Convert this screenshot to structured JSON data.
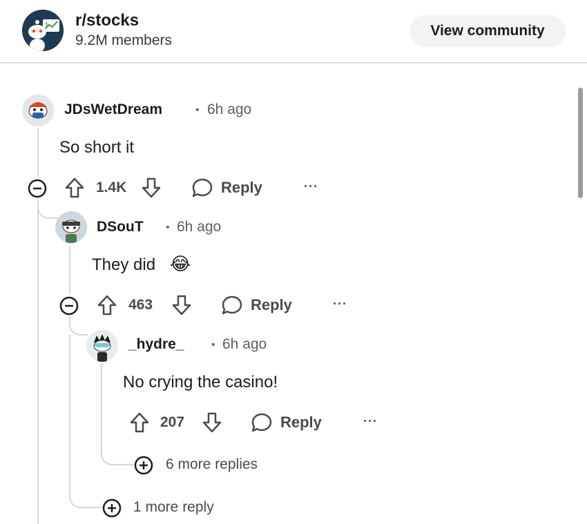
{
  "header": {
    "subreddit": "r/stocks",
    "members": "9.2M members",
    "view_button": "View community"
  },
  "comments": [
    {
      "author": "JDsWetDream",
      "separator": "•",
      "time": "6h ago",
      "text": "So short it",
      "score": "1.4K",
      "reply_label": "Reply",
      "more_label": "···"
    },
    {
      "author": "DSouT",
      "separator": "•",
      "time": "6h ago",
      "text": "They did",
      "emoji": "😂",
      "score": "463",
      "reply_label": "Reply",
      "more_label": "···"
    },
    {
      "author": "_hydre_",
      "separator": "•",
      "time": "6h ago",
      "text": "No crying the casino!",
      "score": "207",
      "reply_label": "Reply",
      "more_label": "···"
    }
  ],
  "more_replies": [
    {
      "label": "6 more replies"
    },
    {
      "label": "1 more reply"
    }
  ],
  "colors": {
    "thread_line": "#d4d7d9",
    "text_primary": "#1c1c1c",
    "text_secondary": "#4a4a4a",
    "button_bg": "#f1f3f4"
  }
}
